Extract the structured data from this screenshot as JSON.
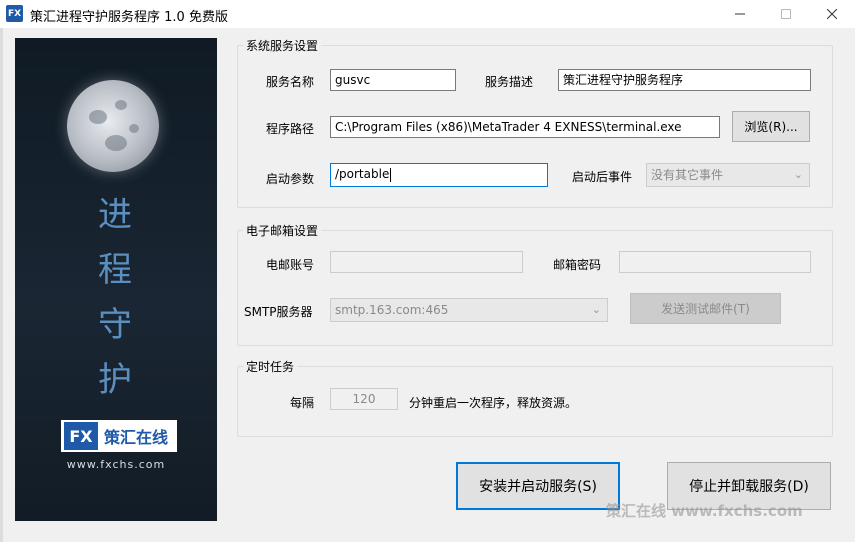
{
  "window": {
    "icon_text": "FX",
    "title": "策汇进程守护服务程序 1.0 免费版"
  },
  "banner": {
    "vertical_text": [
      "进",
      "程",
      "守",
      "护"
    ],
    "logo_fx": "FX",
    "logo_cn": "策汇在线",
    "url": "www.fxchs.com"
  },
  "system_service": {
    "title": "系统服务设置",
    "service_name_label": "服务名称",
    "service_name_value": "gusvc",
    "service_desc_label": "服务描述",
    "service_desc_value": "策汇进程守护服务程序",
    "program_path_label": "程序路径",
    "program_path_value": "C:\\Program Files (x86)\\MetaTrader 4 EXNESS\\terminal.exe",
    "browse_button": "浏览(R)...",
    "start_params_label": "启动参数",
    "start_params_value": "/portable",
    "after_start_label": "启动后事件",
    "after_start_value": "没有其它事件"
  },
  "email": {
    "title": "电子邮箱设置",
    "account_label": "电邮账号",
    "account_value": "",
    "password_label": "邮箱密码",
    "password_value": "",
    "smtp_label": "SMTP服务器",
    "smtp_value": "smtp.163.com:465",
    "test_button": "发送测试邮件(T)"
  },
  "timer": {
    "title": "定时任务",
    "interval_label": "每隔",
    "interval_value": "120",
    "interval_suffix": "分钟重启一次程序，释放资源。"
  },
  "actions": {
    "install_button": "安装并启动服务(S)",
    "stop_button": "停止并卸载服务(D)"
  },
  "watermark": "策汇在线 www.fxchs.com",
  "colors": {
    "brand": "#1e5aa8",
    "focus": "#0078d7",
    "window_bg": "#f0f0f0"
  }
}
